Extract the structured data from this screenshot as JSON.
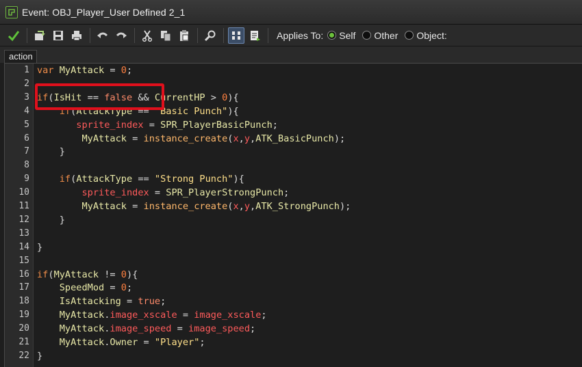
{
  "window": {
    "title": "Event: OBJ_Player_User Defined 2_1"
  },
  "toolbar": {
    "applies_to_label": "Applies To:",
    "options": [
      {
        "label": "Self",
        "checked": true
      },
      {
        "label": "Other",
        "checked": false
      },
      {
        "label": "Object:",
        "checked": false
      }
    ],
    "icons": [
      "ok-checkmark-icon",
      "import-icon",
      "save-icon",
      "print-icon",
      "undo-icon",
      "redo-icon",
      "cut-icon",
      "copy-icon",
      "paste-icon",
      "find-icon",
      "code-view-toggle-icon",
      "script-sheet-icon"
    ]
  },
  "tabs": [
    {
      "label": "action"
    }
  ],
  "editor": {
    "lines": [
      {
        "no": "1",
        "text": "var MyAttack = 0;"
      },
      {
        "no": "2",
        "text": ""
      },
      {
        "no": "3",
        "text": "if(IsHit == false && CurrentHP > 0){"
      },
      {
        "no": "4",
        "text": "    if(AttackType == \"Basic Punch\"){"
      },
      {
        "no": "5",
        "text": "       sprite_index = SPR_PlayerBasicPunch;"
      },
      {
        "no": "6",
        "text": "        MyAttack = instance_create(x,y,ATK_BasicPunch);"
      },
      {
        "no": "7",
        "text": "    }"
      },
      {
        "no": "8",
        "text": ""
      },
      {
        "no": "9",
        "text": "    if(AttackType == \"Strong Punch\"){"
      },
      {
        "no": "10",
        "text": "        sprite_index = SPR_PlayerStrongPunch;"
      },
      {
        "no": "11",
        "text": "        MyAttack = instance_create(x,y,ATK_StrongPunch);"
      },
      {
        "no": "12",
        "text": "    }"
      },
      {
        "no": "13",
        "text": ""
      },
      {
        "no": "14",
        "text": "}"
      },
      {
        "no": "15",
        "text": ""
      },
      {
        "no": "16",
        "text": "if(MyAttack != 0){"
      },
      {
        "no": "17",
        "text": "    SpeedMod = 0;"
      },
      {
        "no": "18",
        "text": "    IsAttacking = true;"
      },
      {
        "no": "19",
        "text": "    MyAttack.image_xscale = image_xscale;"
      },
      {
        "no": "20",
        "text": "    MyAttack.image_speed = image_speed;"
      },
      {
        "no": "21",
        "text": "    MyAttack.Owner = \"Player\";"
      },
      {
        "no": "22",
        "text": "}"
      }
    ]
  },
  "colors": {
    "background": "#1e1e1e",
    "highlight_box": "#e0101c",
    "radio_selected": "#6cc03c"
  }
}
